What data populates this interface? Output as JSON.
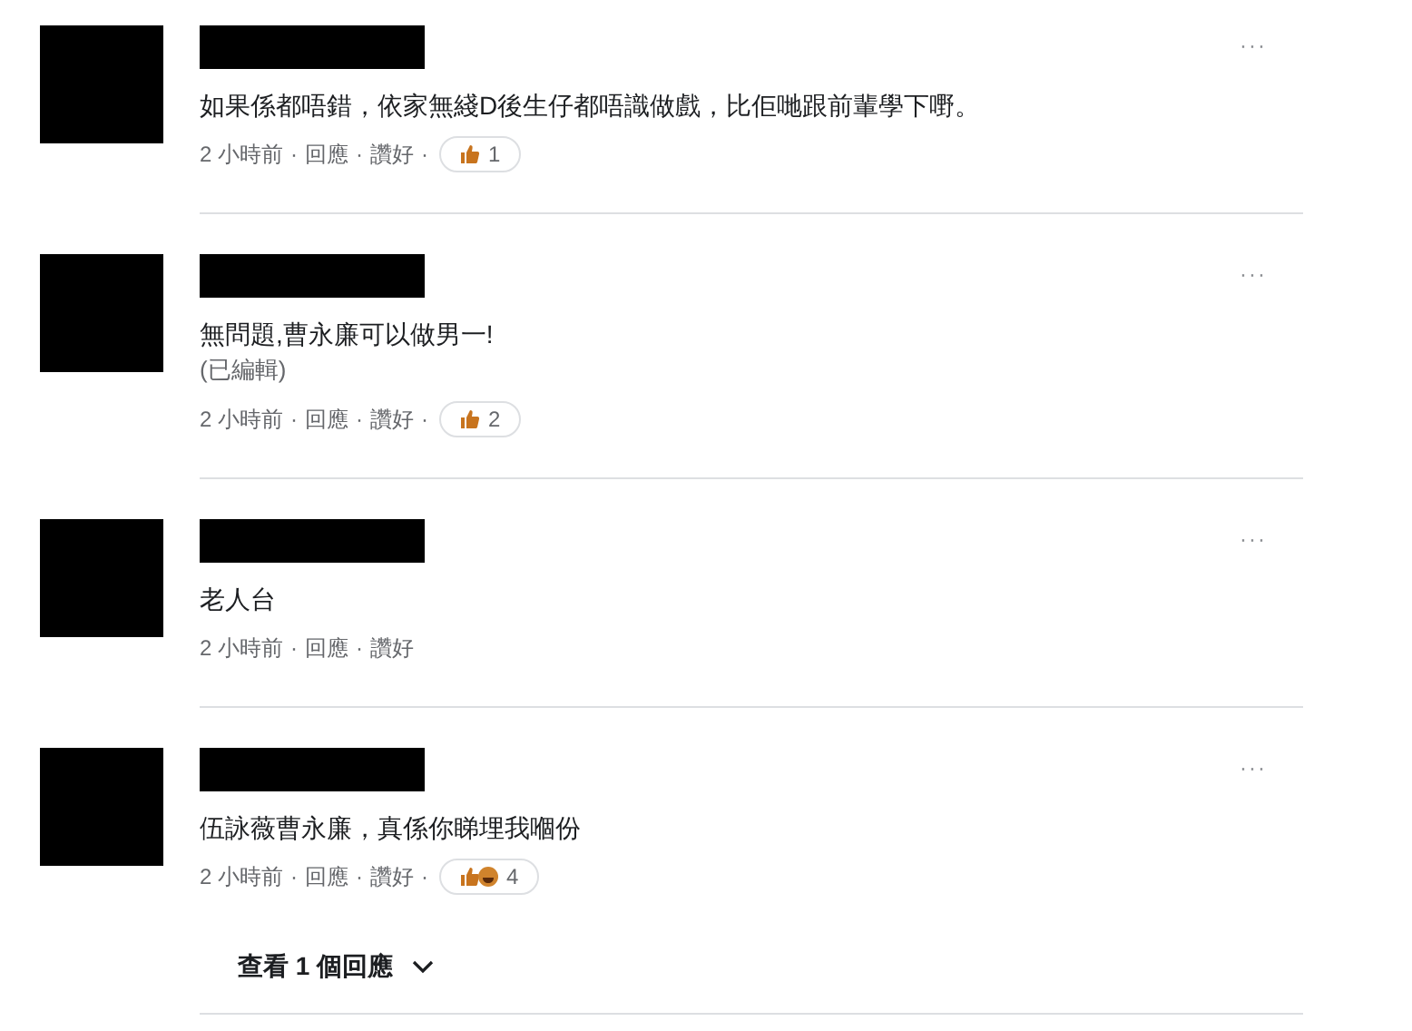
{
  "comments": [
    {
      "text": "如果係都唔錯，依家無綫D後生仔都唔識做戲，比佢哋跟前輩學下嘢。",
      "time": "2 小時前",
      "reply": "回應",
      "like": "讚好",
      "separator": "·",
      "reactions": {
        "icons": [
          {
            "kind": "like"
          }
        ],
        "count": "1"
      }
    },
    {
      "text": "無問題,曹永廉可以做男一!",
      "edited": "(已編輯)",
      "time": "2 小時前",
      "reply": "回應",
      "like": "讚好",
      "separator": "·",
      "reactions": {
        "icons": [
          {
            "kind": "like"
          }
        ],
        "count": "2"
      }
    },
    {
      "text": "老人台",
      "time": "2 小時前",
      "reply": "回應",
      "like": "讚好",
      "separator": "·"
    },
    {
      "text": "伍詠薇曹永廉，真係你睇埋我嗰份",
      "time": "2 小時前",
      "reply": "回應",
      "like": "讚好",
      "separator": "·",
      "reactions": {
        "icons": [
          {
            "kind": "like"
          },
          {
            "kind": "haha"
          }
        ],
        "count": "4"
      }
    }
  ],
  "more_options": "···",
  "view_replies": "查看 1 個回應"
}
